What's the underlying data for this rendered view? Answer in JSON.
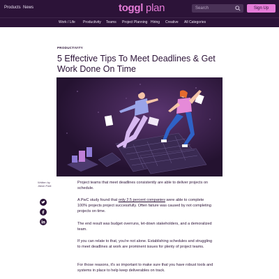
{
  "header": {
    "nav": [
      "Products",
      "News"
    ],
    "logo_bold": "toggl",
    "logo_light": " plan",
    "search_placeholder": "Search",
    "signup_label": "Sign Up"
  },
  "categories": [
    "Work / Life",
    "Productivity",
    "Teams",
    "Project Planning",
    "Hiring",
    "Creative",
    "All Categories"
  ],
  "article": {
    "kicker": "PRODUCTIVITY",
    "title": "5 Effective Tips To Meet Deadlines & Get Work Done On Time",
    "author": "Written by Jitesh Patil",
    "paragraphs": {
      "p1": "Project teams that meet deadlines consistently are able to deliver projects on schedule.",
      "p2_before": "A PwC study found that ",
      "p2_link": "only 2.5 percent companies",
      "p2_after": " were able to complete 100% projects project successfully. Often failure was caused by not completing projects on time.",
      "p3": "The end result was budget overruns, let-down stakeholders, and a demoralized team.",
      "p4": "If you can relate to that, you're not alone. Establishing schedules and struggling to meet deadlines at work are prominent issues for plenty of project teams.",
      "p5": "For those reasons, it's so important to make sure that you have robust tools and systems in place to help keep deliverables on track."
    }
  },
  "share_icons": [
    "twitter-icon",
    "facebook-icon",
    "linkedin-icon"
  ],
  "colors": {
    "brand_dark": "#2c1338",
    "brand_pink": "#e57cd8"
  }
}
